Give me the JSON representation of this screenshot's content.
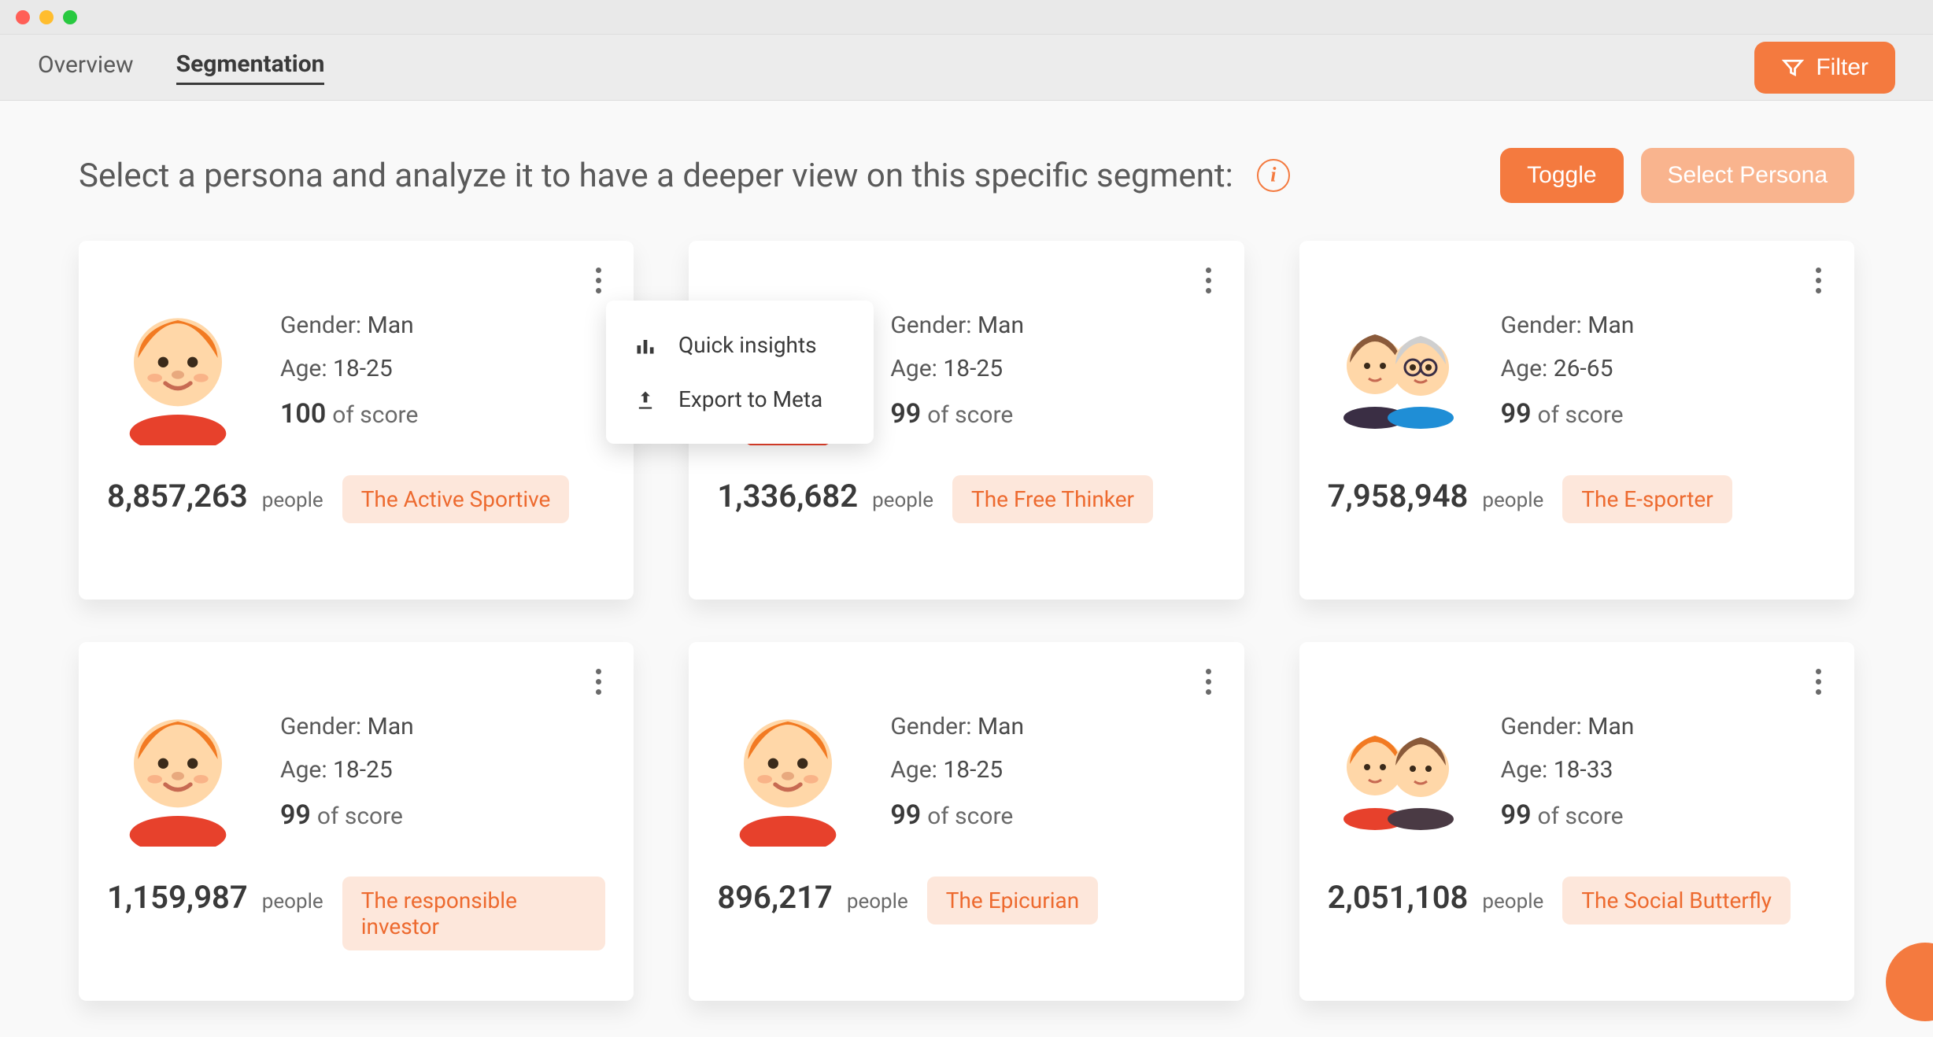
{
  "tabs": {
    "overview": "Overview",
    "segmentation": "Segmentation"
  },
  "filter_label": "Filter",
  "header": {
    "title": "Select a persona and analyze it to have a deeper view on this specific segment:",
    "toggle_label": "Toggle",
    "select_label": "Select Persona"
  },
  "card_labels": {
    "gender": "Gender:",
    "age": "Age:",
    "of_score": "of score",
    "people": "people"
  },
  "menu": {
    "quick_insights": "Quick insights",
    "export_meta": "Export to Meta"
  },
  "cards": [
    {
      "gender": "Man",
      "age": "18-25",
      "score": "100",
      "people": "8,857,263",
      "name": "The Active Sportive",
      "avatar": "single-orange"
    },
    {
      "gender": "Man",
      "age": "18-25",
      "score": "99",
      "people": "1,336,682",
      "name": "The Free Thinker",
      "avatar": "single-orange"
    },
    {
      "gender": "Man",
      "age": "26-65",
      "score": "99",
      "people": "7,958,948",
      "name": "The E-sporter",
      "avatar": "pair-old"
    },
    {
      "gender": "Man",
      "age": "18-25",
      "score": "99",
      "people": "1,159,987",
      "name": "The responsible investor",
      "avatar": "single-orange"
    },
    {
      "gender": "Man",
      "age": "18-25",
      "score": "99",
      "people": "896,217",
      "name": "The Epicurian",
      "avatar": "single-orange"
    },
    {
      "gender": "Man",
      "age": "18-33",
      "score": "99",
      "people": "2,051,108",
      "name": "The Social Butterfly",
      "avatar": "pair-young"
    }
  ]
}
